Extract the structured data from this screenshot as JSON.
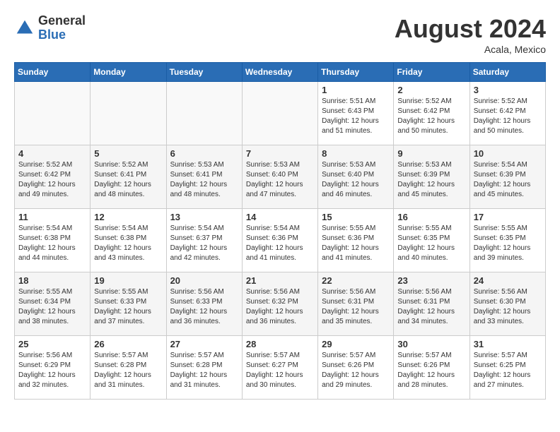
{
  "header": {
    "logo_general": "General",
    "logo_blue": "Blue",
    "month_year": "August 2024",
    "location": "Acala, Mexico"
  },
  "days_of_week": [
    "Sunday",
    "Monday",
    "Tuesday",
    "Wednesday",
    "Thursday",
    "Friday",
    "Saturday"
  ],
  "weeks": [
    [
      {
        "day": "",
        "sunrise": "",
        "sunset": "",
        "daylight": ""
      },
      {
        "day": "",
        "sunrise": "",
        "sunset": "",
        "daylight": ""
      },
      {
        "day": "",
        "sunrise": "",
        "sunset": "",
        "daylight": ""
      },
      {
        "day": "",
        "sunrise": "",
        "sunset": "",
        "daylight": ""
      },
      {
        "day": "1",
        "sunrise": "Sunrise: 5:51 AM",
        "sunset": "Sunset: 6:43 PM",
        "daylight": "Daylight: 12 hours and 51 minutes."
      },
      {
        "day": "2",
        "sunrise": "Sunrise: 5:52 AM",
        "sunset": "Sunset: 6:42 PM",
        "daylight": "Daylight: 12 hours and 50 minutes."
      },
      {
        "day": "3",
        "sunrise": "Sunrise: 5:52 AM",
        "sunset": "Sunset: 6:42 PM",
        "daylight": "Daylight: 12 hours and 50 minutes."
      }
    ],
    [
      {
        "day": "4",
        "sunrise": "Sunrise: 5:52 AM",
        "sunset": "Sunset: 6:42 PM",
        "daylight": "Daylight: 12 hours and 49 minutes."
      },
      {
        "day": "5",
        "sunrise": "Sunrise: 5:52 AM",
        "sunset": "Sunset: 6:41 PM",
        "daylight": "Daylight: 12 hours and 48 minutes."
      },
      {
        "day": "6",
        "sunrise": "Sunrise: 5:53 AM",
        "sunset": "Sunset: 6:41 PM",
        "daylight": "Daylight: 12 hours and 48 minutes."
      },
      {
        "day": "7",
        "sunrise": "Sunrise: 5:53 AM",
        "sunset": "Sunset: 6:40 PM",
        "daylight": "Daylight: 12 hours and 47 minutes."
      },
      {
        "day": "8",
        "sunrise": "Sunrise: 5:53 AM",
        "sunset": "Sunset: 6:40 PM",
        "daylight": "Daylight: 12 hours and 46 minutes."
      },
      {
        "day": "9",
        "sunrise": "Sunrise: 5:53 AM",
        "sunset": "Sunset: 6:39 PM",
        "daylight": "Daylight: 12 hours and 45 minutes."
      },
      {
        "day": "10",
        "sunrise": "Sunrise: 5:54 AM",
        "sunset": "Sunset: 6:39 PM",
        "daylight": "Daylight: 12 hours and 45 minutes."
      }
    ],
    [
      {
        "day": "11",
        "sunrise": "Sunrise: 5:54 AM",
        "sunset": "Sunset: 6:38 PM",
        "daylight": "Daylight: 12 hours and 44 minutes."
      },
      {
        "day": "12",
        "sunrise": "Sunrise: 5:54 AM",
        "sunset": "Sunset: 6:38 PM",
        "daylight": "Daylight: 12 hours and 43 minutes."
      },
      {
        "day": "13",
        "sunrise": "Sunrise: 5:54 AM",
        "sunset": "Sunset: 6:37 PM",
        "daylight": "Daylight: 12 hours and 42 minutes."
      },
      {
        "day": "14",
        "sunrise": "Sunrise: 5:54 AM",
        "sunset": "Sunset: 6:36 PM",
        "daylight": "Daylight: 12 hours and 41 minutes."
      },
      {
        "day": "15",
        "sunrise": "Sunrise: 5:55 AM",
        "sunset": "Sunset: 6:36 PM",
        "daylight": "Daylight: 12 hours and 41 minutes."
      },
      {
        "day": "16",
        "sunrise": "Sunrise: 5:55 AM",
        "sunset": "Sunset: 6:35 PM",
        "daylight": "Daylight: 12 hours and 40 minutes."
      },
      {
        "day": "17",
        "sunrise": "Sunrise: 5:55 AM",
        "sunset": "Sunset: 6:35 PM",
        "daylight": "Daylight: 12 hours and 39 minutes."
      }
    ],
    [
      {
        "day": "18",
        "sunrise": "Sunrise: 5:55 AM",
        "sunset": "Sunset: 6:34 PM",
        "daylight": "Daylight: 12 hours and 38 minutes."
      },
      {
        "day": "19",
        "sunrise": "Sunrise: 5:55 AM",
        "sunset": "Sunset: 6:33 PM",
        "daylight": "Daylight: 12 hours and 37 minutes."
      },
      {
        "day": "20",
        "sunrise": "Sunrise: 5:56 AM",
        "sunset": "Sunset: 6:33 PM",
        "daylight": "Daylight: 12 hours and 36 minutes."
      },
      {
        "day": "21",
        "sunrise": "Sunrise: 5:56 AM",
        "sunset": "Sunset: 6:32 PM",
        "daylight": "Daylight: 12 hours and 36 minutes."
      },
      {
        "day": "22",
        "sunrise": "Sunrise: 5:56 AM",
        "sunset": "Sunset: 6:31 PM",
        "daylight": "Daylight: 12 hours and 35 minutes."
      },
      {
        "day": "23",
        "sunrise": "Sunrise: 5:56 AM",
        "sunset": "Sunset: 6:31 PM",
        "daylight": "Daylight: 12 hours and 34 minutes."
      },
      {
        "day": "24",
        "sunrise": "Sunrise: 5:56 AM",
        "sunset": "Sunset: 6:30 PM",
        "daylight": "Daylight: 12 hours and 33 minutes."
      }
    ],
    [
      {
        "day": "25",
        "sunrise": "Sunrise: 5:56 AM",
        "sunset": "Sunset: 6:29 PM",
        "daylight": "Daylight: 12 hours and 32 minutes."
      },
      {
        "day": "26",
        "sunrise": "Sunrise: 5:57 AM",
        "sunset": "Sunset: 6:28 PM",
        "daylight": "Daylight: 12 hours and 31 minutes."
      },
      {
        "day": "27",
        "sunrise": "Sunrise: 5:57 AM",
        "sunset": "Sunset: 6:28 PM",
        "daylight": "Daylight: 12 hours and 31 minutes."
      },
      {
        "day": "28",
        "sunrise": "Sunrise: 5:57 AM",
        "sunset": "Sunset: 6:27 PM",
        "daylight": "Daylight: 12 hours and 30 minutes."
      },
      {
        "day": "29",
        "sunrise": "Sunrise: 5:57 AM",
        "sunset": "Sunset: 6:26 PM",
        "daylight": "Daylight: 12 hours and 29 minutes."
      },
      {
        "day": "30",
        "sunrise": "Sunrise: 5:57 AM",
        "sunset": "Sunset: 6:26 PM",
        "daylight": "Daylight: 12 hours and 28 minutes."
      },
      {
        "day": "31",
        "sunrise": "Sunrise: 5:57 AM",
        "sunset": "Sunset: 6:25 PM",
        "daylight": "Daylight: 12 hours and 27 minutes."
      }
    ]
  ]
}
